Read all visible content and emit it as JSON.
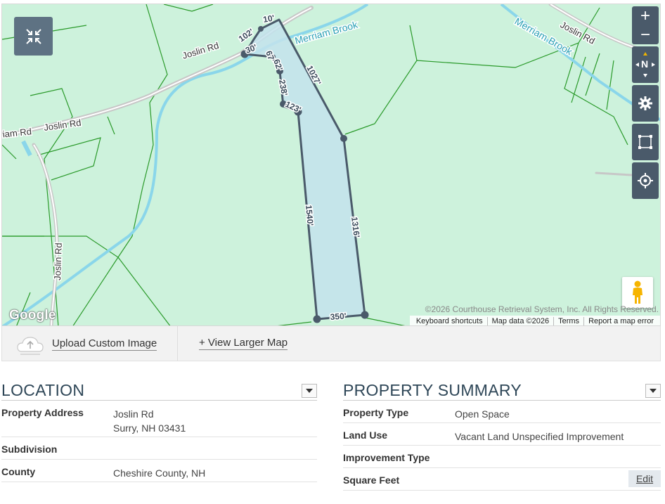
{
  "map": {
    "road_labels": [
      "Joslin Rd",
      "Joslin Rd",
      "Joslin Rd",
      "Joslin Rd",
      "riam Rd"
    ],
    "water_labels": [
      "Merriam Brook",
      "Merriam Brook"
    ],
    "parcel_dimensions": [
      "10'",
      "102'",
      "30'",
      "67'",
      "62'",
      "238'",
      "123'",
      "1027'",
      "1540'",
      "1316'",
      "350'"
    ],
    "google_logo": "Google",
    "copyright": "©2026 Courthouse Retrieval System, Inc. All Rights Reserved.",
    "footer": [
      "Keyboard shortcuts",
      "Map data ©2026",
      "Terms",
      "Report a map error"
    ],
    "zoom_in": "+",
    "zoom_out": "−",
    "compass_label": "N",
    "colors": {
      "background": "#cdf2dc",
      "parcel_fill": "#c3e3ec",
      "parcel_stroke": "#4a5a6a",
      "water": "#8ad6ea",
      "lot_lines": "#2a9a2a"
    }
  },
  "toolbar": {
    "upload_label": "Upload Custom Image",
    "view_larger_label": "+ View Larger Map"
  },
  "location": {
    "title": "LOCATION",
    "rows": [
      {
        "label": "Property Address",
        "line1": "Joslin Rd",
        "line2": "Surry, NH 03431"
      },
      {
        "label": "Subdivision",
        "value": ""
      },
      {
        "label": "County",
        "value": "Cheshire County, NH"
      }
    ]
  },
  "summary": {
    "title": "PROPERTY SUMMARY",
    "rows": [
      {
        "label": "Property Type",
        "value": "Open Space"
      },
      {
        "label": "Land Use",
        "value": "Vacant Land Unspecified Improvement"
      },
      {
        "label": "Improvement Type",
        "value": ""
      },
      {
        "label": "Square Feet",
        "value": ""
      }
    ],
    "edit_label": "Edit"
  }
}
